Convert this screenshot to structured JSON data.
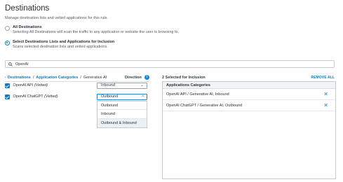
{
  "header": {
    "title": "Destinations",
    "subtitle": "Manage destination lists and vetted applications for this rule."
  },
  "options": [
    {
      "label": "All Destinations",
      "description": "Selecting All Destinations will scan the traffic to any application or website the user is browsing to.",
      "selected": false
    },
    {
      "label": "Select Destinations Lists and Applications for Inclusion",
      "description": "Scans selected destination lists and vetted applications.",
      "selected": true
    }
  ],
  "search": {
    "value": "OpenAI",
    "icon": "search-icon"
  },
  "breadcrumb": {
    "items": [
      "Destinations",
      "Application Categories",
      "Generative AI"
    ],
    "separator": "/"
  },
  "direction_header": "Direction",
  "apps": [
    {
      "name": "OpenAI API",
      "vetted": "(Vetted)",
      "checked": true,
      "direction": "Inbound"
    },
    {
      "name": "OpenAI ChatGPT",
      "vetted": "(Vetted)",
      "checked": true,
      "direction": "Outbound"
    }
  ],
  "dropdown": {
    "options": [
      "Outbound",
      "Inbound",
      "Outbound & Inbound"
    ],
    "highlighted": "Outbound & Inbound"
  },
  "selected_panel": {
    "count_label": "2 Selected for Inclusion",
    "remove_all": "REMOVE ALL",
    "header": "Applications Categories",
    "rows": [
      "OpenAI API / Generative AI, Inbound",
      "OpenAI ChatGPT / Generative AI, Outbound"
    ]
  },
  "colors": {
    "accent": "#0d7ac2",
    "info": "#1b87d4",
    "highlight_bg": "#e8f1f8"
  }
}
